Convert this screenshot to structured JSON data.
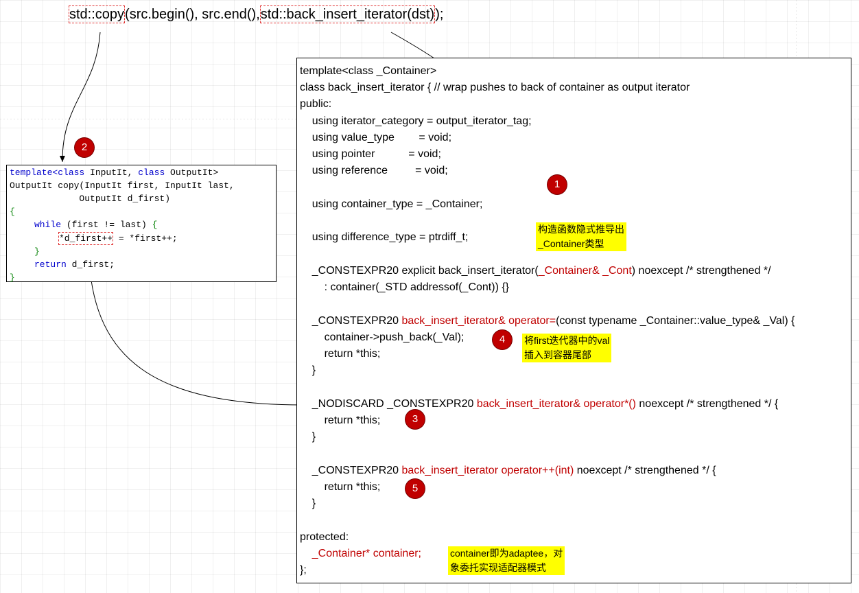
{
  "call": {
    "copy": "std::copy",
    "args": "(src.begin(), src.end(),",
    "bii": "std::back_insert_iterator(dst)",
    "end": ");"
  },
  "copy_code": {
    "l1_kw1": "template<class",
    "l1_a": " InputIt, ",
    "l1_kw2": "class",
    "l1_b": " OutputIt>",
    "l2": "OutputIt copy(InputIt first, InputIt last,",
    "l3": "             OutputIt d_first)",
    "l4": "{",
    "l5_kw": "while",
    "l5_a": " (first != last) ",
    "l5_b": "{",
    "l6_hl": "*d_first++",
    "l6_rest": " = *first++;",
    "l7": "}",
    "l8_kw": "return",
    "l8_rest": " d_first;",
    "l9": "}"
  },
  "class_code": {
    "t1": "template<class _Container>",
    "t2": "class back_insert_iterator { // wrap pushes to back of container as output iterator",
    "t3": "public:",
    "t4": "    using iterator_category = output_iterator_tag;",
    "t5": "    using value_type        = void;",
    "t6": "    using pointer           = void;",
    "t7": "    using reference         = void;",
    "t8": "    using container_type = _Container;",
    "t9": "    using difference_type = ptrdiff_t;",
    "c1a": "    _CONSTEXPR20 explicit back_insert_iterator(",
    "c1b": "_Container& _Cont",
    "c1c": ") noexcept /* strengthened */",
    "c2": "        : container(_STD addressof(_Cont)) {}",
    "o1a": "    _CONSTEXPR20 ",
    "o1b": "back_insert_iterator& operator=",
    "o1c": "(const typename _Container::value_type& _Val) {",
    "o2": "        container->push_back(_Val);",
    "o3": "        return *this;",
    "o4": "    }",
    "d1a": "    _NODISCARD _CONSTEXPR20 ",
    "d1b": "back_insert_iterator& operator*()",
    "d1c": " noexcept /* strengthened */ {",
    "d2": "        return *this;",
    "d3": "    }",
    "p1a": "    _CONSTEXPR20 ",
    "p1b": "back_insert_iterator operator++(int)",
    "p1c": " noexcept /* strengthened */ {",
    "p2": "        return *this;",
    "p3": "    }",
    "pr1": "protected:",
    "pr2a": "    _Container* ",
    "pr2b": "container;",
    "pr3": "};"
  },
  "badges": [
    "1",
    "2",
    "3",
    "4",
    "5"
  ],
  "notes": {
    "ctor": "构造函数隐式推导出\n_Container类型",
    "insert": "将first迭代器中的val\n插入到容器尾部",
    "adaptee": "container即为adaptee，对\n象委托实现适配器模式"
  },
  "colors": {
    "badge": "#c00000",
    "note": "#ffff00",
    "dash": "#e03030",
    "keyword": "#0000cc",
    "brace": "#118811"
  }
}
